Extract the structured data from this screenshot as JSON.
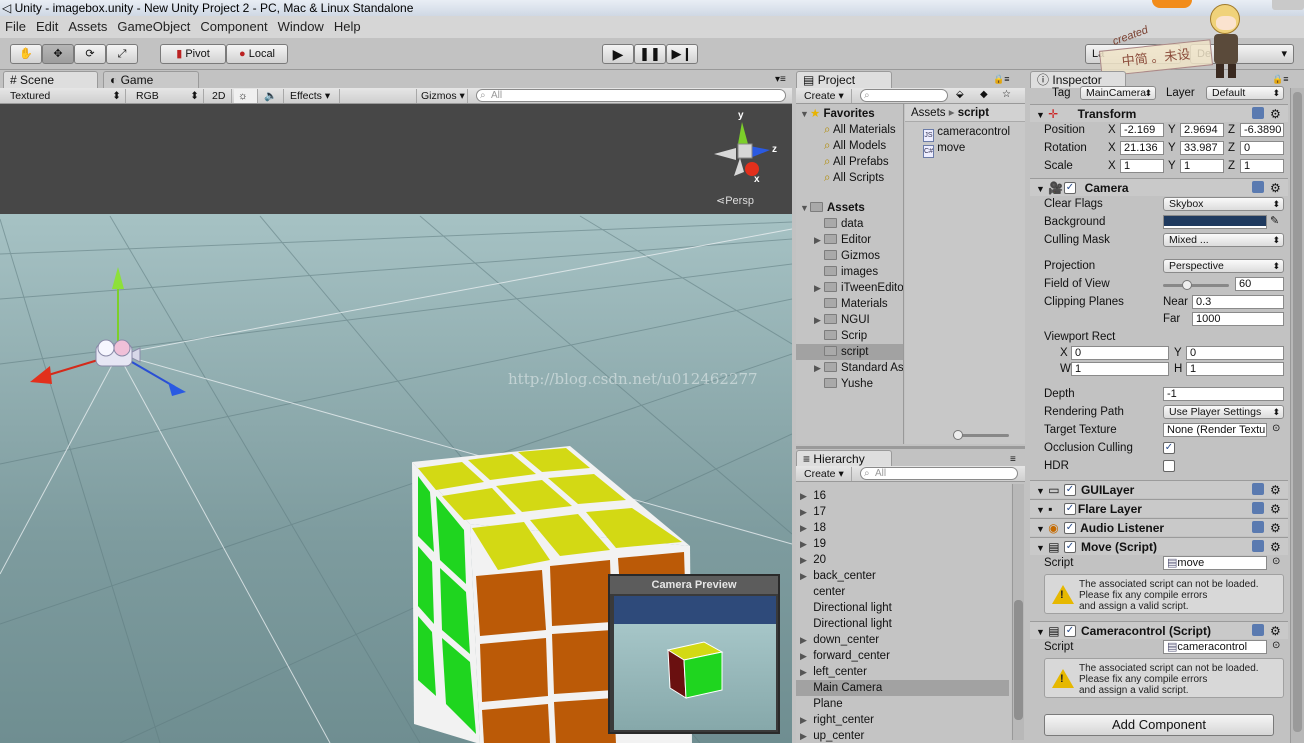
{
  "window": {
    "title": "Unity - imagebox.unity - New Unity Project 2 - PC, Mac & Linux Standalone"
  },
  "menu": [
    "File",
    "Edit",
    "Assets",
    "GameObject",
    "Component",
    "Window",
    "Help"
  ],
  "toolbar": {
    "pivot_label": "Pivot",
    "local_label": "Local",
    "layers_label": "La",
    "layout_label": "De"
  },
  "overlay": {
    "stamp_text": "中简 。未设",
    "avatar_caption": "created"
  },
  "scene": {
    "tab_scene": "Scene",
    "tab_game": "Game",
    "shading": "Textured",
    "render": "RGB",
    "mode_2d": "2D",
    "effects": "Effects",
    "gizmos": "Gizmos",
    "search_placeholder": "All",
    "persp_label": "Persp",
    "axis_x": "x",
    "axis_y": "y",
    "axis_z": "z",
    "watermark": "http://blog.csdn.net/u012462277",
    "camera_preview_title": "Camera Preview"
  },
  "project": {
    "tab": "Project",
    "create": "Create",
    "favorites_label": "Favorites",
    "favorites": [
      "All Materials",
      "All Models",
      "All Prefabs",
      "All Scripts"
    ],
    "assets_label": "Assets",
    "folders": [
      {
        "name": "data",
        "expandable": false
      },
      {
        "name": "Editor",
        "expandable": true
      },
      {
        "name": "Gizmos",
        "expandable": false
      },
      {
        "name": "images",
        "expandable": false
      },
      {
        "name": "iTweenEditor",
        "expandable": true
      },
      {
        "name": "Materials",
        "expandable": false
      },
      {
        "name": "NGUI",
        "expandable": true
      },
      {
        "name": "Scrip",
        "expandable": false
      },
      {
        "name": "script",
        "expandable": false,
        "selected": true
      },
      {
        "name": "Standard Assets",
        "expandable": true
      },
      {
        "name": "Yushe",
        "expandable": false
      }
    ],
    "breadcrumb_root": "Assets",
    "breadcrumb_sep": "▸",
    "breadcrumb_current": "script",
    "files": [
      "cameracontrol",
      "move"
    ]
  },
  "hierarchy": {
    "tab": "Hierarchy",
    "create": "Create",
    "search_placeholder": "All",
    "items": [
      {
        "name": "16",
        "expandable": true
      },
      {
        "name": "17",
        "expandable": true
      },
      {
        "name": "18",
        "expandable": true
      },
      {
        "name": "19",
        "expandable": true
      },
      {
        "name": "20",
        "expandable": true
      },
      {
        "name": "back_center",
        "expandable": true
      },
      {
        "name": "center",
        "expandable": false
      },
      {
        "name": "Directional light",
        "expandable": false
      },
      {
        "name": "Directional light",
        "expandable": false
      },
      {
        "name": "down_center",
        "expandable": true
      },
      {
        "name": "forward_center",
        "expandable": true
      },
      {
        "name": "left_center",
        "expandable": true
      },
      {
        "name": "Main Camera",
        "expandable": false,
        "selected": true
      },
      {
        "name": "Plane",
        "expandable": false
      },
      {
        "name": "right_center",
        "expandable": true
      },
      {
        "name": "up_center",
        "expandable": true
      }
    ]
  },
  "inspector": {
    "tab": "Inspector",
    "tag_label": "Tag",
    "tag_value": "MainCamera",
    "layer_label": "Layer",
    "layer_value": "Default",
    "transform": {
      "title": "Transform",
      "position_label": "Position",
      "rotation_label": "Rotation",
      "scale_label": "Scale",
      "x_label": "X",
      "y_label": "Y",
      "z_label": "Z",
      "position": [
        "-2.169",
        "2.9694",
        "-6.3890"
      ],
      "rotation": [
        "21.136",
        "33.987",
        "0"
      ],
      "scale": [
        "1",
        "1",
        "1"
      ]
    },
    "camera": {
      "title": "Camera",
      "clear_flags_label": "Clear Flags",
      "clear_flags": "Skybox",
      "background_label": "Background",
      "background_color": "#1f3a5f",
      "culling_mask_label": "Culling Mask",
      "culling_mask": "Mixed ...",
      "projection_label": "Projection",
      "projection": "Perspective",
      "fov_label": "Field of View",
      "fov": "60",
      "clipping_label": "Clipping Planes",
      "near_label": "Near",
      "near": "0.3",
      "far_label": "Far",
      "far": "1000",
      "viewport_label": "Viewport Rect",
      "vp_x_label": "X",
      "vp_y_label": "Y",
      "vp_w_label": "W",
      "vp_h_label": "H",
      "vp_x": "0",
      "vp_y": "0",
      "vp_w": "1",
      "vp_h": "1",
      "depth_label": "Depth",
      "depth": "-1",
      "rendering_path_label": "Rendering Path",
      "rendering_path": "Use Player Settings",
      "target_texture_label": "Target Texture",
      "target_texture": "None (Render Texture)",
      "occlusion_label": "Occlusion Culling",
      "occlusion": true,
      "hdr_label": "HDR",
      "hdr": false
    },
    "components": {
      "guilayer": "GUILayer",
      "flare": "Flare Layer",
      "audio": "Audio Listener",
      "move_script": "Move (Script)",
      "camctl_script": "Cameracontrol (Script)"
    },
    "script_label": "Script",
    "move_script_value": "move",
    "camctl_script_value": "cameracontrol",
    "warning_line1": "The associated script can not be loaded.",
    "warning_line2": "Please fix any compile errors",
    "warning_line3": "and assign a valid script.",
    "add_component": "Add Component"
  }
}
